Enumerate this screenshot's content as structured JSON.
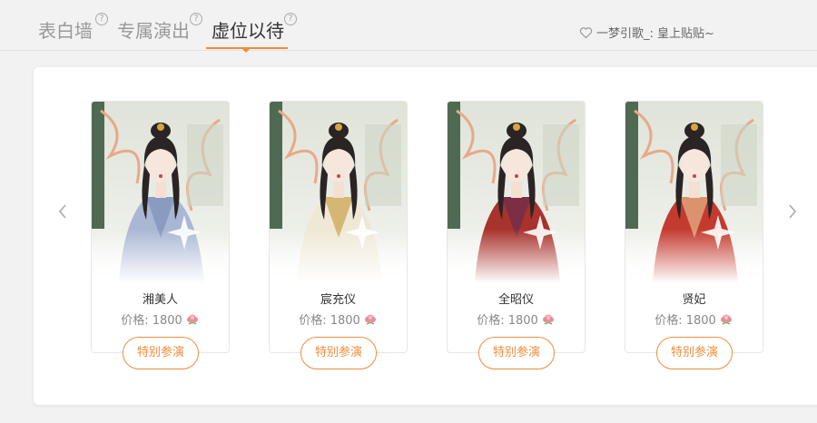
{
  "tabs": [
    {
      "label": "表白墙",
      "help": "?"
    },
    {
      "label": "专属演出",
      "help": "?"
    },
    {
      "label": "虚位以待",
      "help": "?"
    }
  ],
  "user": {
    "text": "一梦引歌_: 皇上贴贴~",
    "icon": "heart-outline-icon"
  },
  "cards": [
    {
      "name": "湘美人",
      "price_label": "价格: 1800",
      "button": "特别参演",
      "robe": "#a9b7d4",
      "accent": "#7d8fb8"
    },
    {
      "name": "宸充仪",
      "price_label": "价格: 1800",
      "button": "特别参演",
      "robe": "#efe8d6",
      "accent": "#c9a24a"
    },
    {
      "name": "全昭仪",
      "price_label": "价格: 1800",
      "button": "特别参演",
      "robe": "#a8322c",
      "accent": "#6a2d4e"
    },
    {
      "name": "贤妃",
      "price_label": "价格: 1800",
      "button": "特别参演",
      "robe": "#c43a2f",
      "accent": "#e6b98a"
    }
  ],
  "colors": {
    "accent": "#f08c3c",
    "tab_inactive": "#999999",
    "tab_active": "#333333"
  }
}
